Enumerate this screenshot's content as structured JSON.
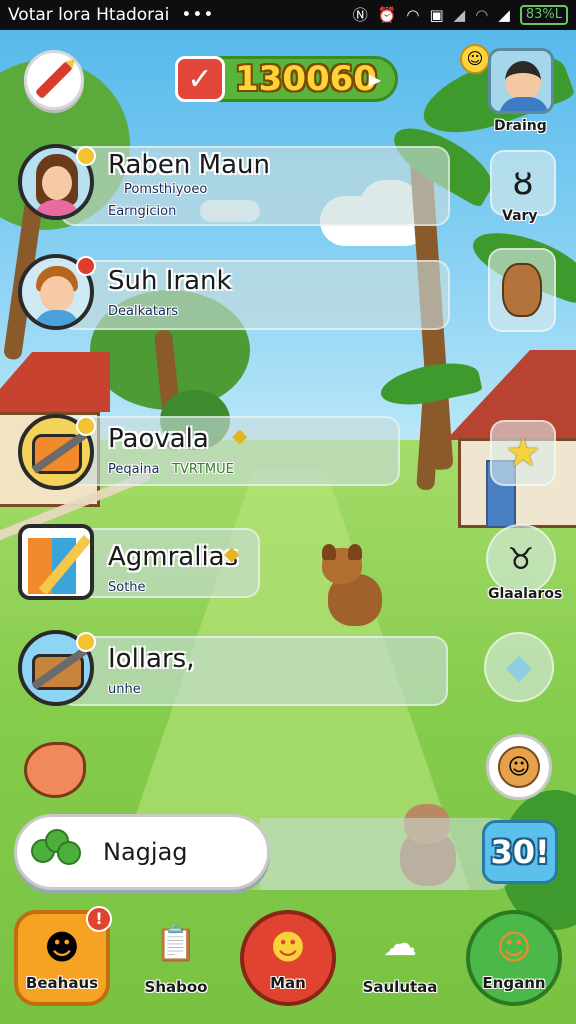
{
  "status_bar": {
    "title": "Votar lora Htadorai",
    "menu_dots": "•••",
    "battery": "83%L"
  },
  "hud": {
    "currency_value": "130060",
    "currency_add": "▶",
    "profile_label": "Draing"
  },
  "friends": [
    {
      "name": "Raben Maun",
      "line1": "Pomsthiyoeo",
      "line2": "Earngicion",
      "notif_color": "#f2c230"
    },
    {
      "name": "Suh Irank",
      "line1": "Dealkatars",
      "line2": "",
      "notif_color": "#e33b2c"
    },
    {
      "name": "Paovala",
      "line1": "Peqaina",
      "line2": "TVRTMUE",
      "notif_color": "#f2c230"
    },
    {
      "name": "Agmralias",
      "line1": "Sothe",
      "line2": "",
      "notif_color": "#f2c230"
    },
    {
      "name": "Iollars,",
      "line1": "unhe",
      "line2": "",
      "notif_color": "#f2c230"
    }
  ],
  "side_buttons": {
    "vary_label": "Vary",
    "glaalaros_label": "Glaalaros"
  },
  "input": {
    "text": "Nagjag",
    "count": "30!"
  },
  "bottom_nav": [
    {
      "label": "Beahaus",
      "icon": "robot-icon",
      "bg": "#f6a323",
      "badge": "!"
    },
    {
      "label": "Shaboo",
      "icon": "clipboard-pencil-icon",
      "bg": "transparent"
    },
    {
      "label": "Man",
      "icon": "smiley-icon",
      "bg": "#e0432f"
    },
    {
      "label": "Saulutaa",
      "icon": "ghost-icon",
      "bg": "transparent"
    },
    {
      "label": "Engann",
      "icon": "face-icon",
      "bg": "#4db84a"
    }
  ],
  "colors": {
    "accent_green": "#58b43a",
    "currency_text": "#ffd43a",
    "panel": "rgba(200,220,220,0.62)"
  }
}
